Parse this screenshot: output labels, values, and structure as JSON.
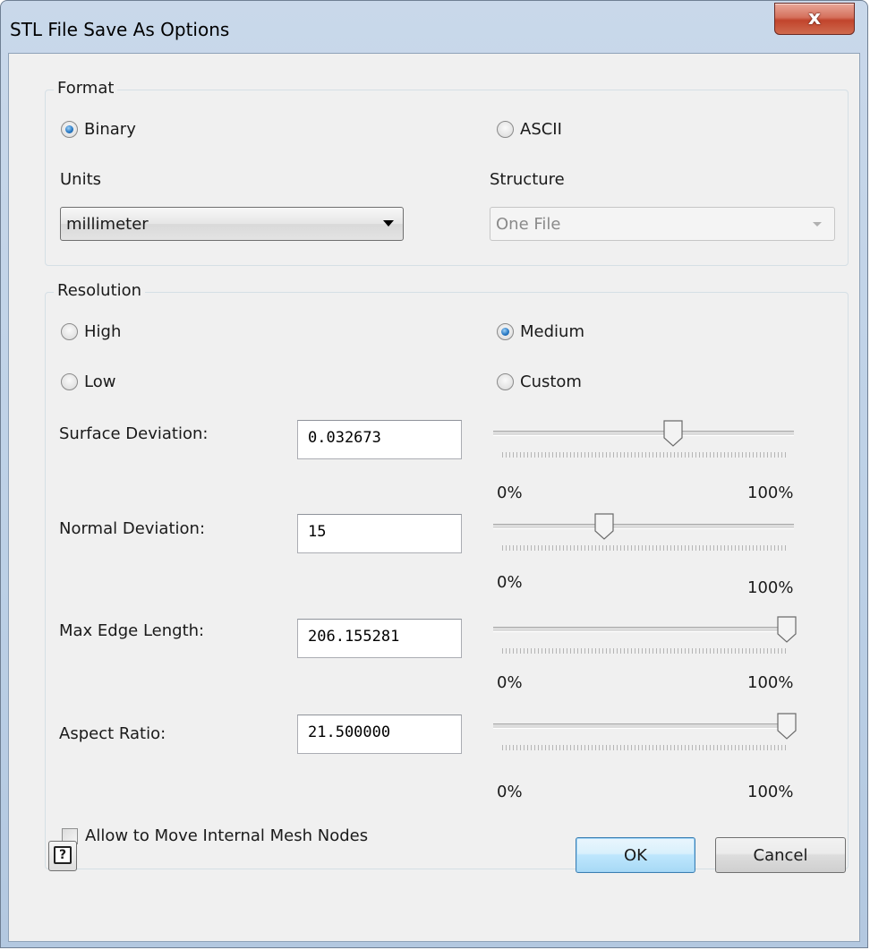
{
  "window": {
    "title": "STL File Save As Options",
    "close_label": "x"
  },
  "format": {
    "group_label": "Format",
    "binary_label": "Binary",
    "ascii_label": "ASCII",
    "selected": "Binary",
    "units_label": "Units",
    "units_value": "millimeter",
    "structure_label": "Structure",
    "structure_value": "One File",
    "structure_enabled": false
  },
  "resolution": {
    "group_label": "Resolution",
    "high_label": "High",
    "medium_label": "Medium",
    "low_label": "Low",
    "custom_label": "Custom",
    "selected": "Medium",
    "params": [
      {
        "label": "Surface Deviation:",
        "value": "0.032673",
        "slider_fraction": 0.6,
        "min_label": "0%",
        "max_label": "100%"
      },
      {
        "label": "Normal Deviation:",
        "value": "15",
        "slider_fraction": 0.36,
        "min_label": "0%",
        "max_label": "100%"
      },
      {
        "label": "Max Edge Length:",
        "value": "206.155281",
        "slider_fraction": 1.0,
        "min_label": "0%",
        "max_label": "100%"
      },
      {
        "label": "Aspect Ratio:",
        "value": "21.500000",
        "slider_fraction": 1.0,
        "min_label": "0%",
        "max_label": "100%"
      }
    ],
    "allow_move_label": "Allow to Move Internal Mesh Nodes",
    "allow_move_checked": false
  },
  "buttons": {
    "help_label": "?",
    "ok_label": "OK",
    "cancel_label": "Cancel"
  },
  "colors": {
    "accent": "#2a7bc6",
    "close_button": "#c1442c",
    "default_button": "#bee6fd"
  },
  "icons": {
    "close": "close-icon",
    "help": "help-icon",
    "dropdown": "chevron-down-icon"
  }
}
